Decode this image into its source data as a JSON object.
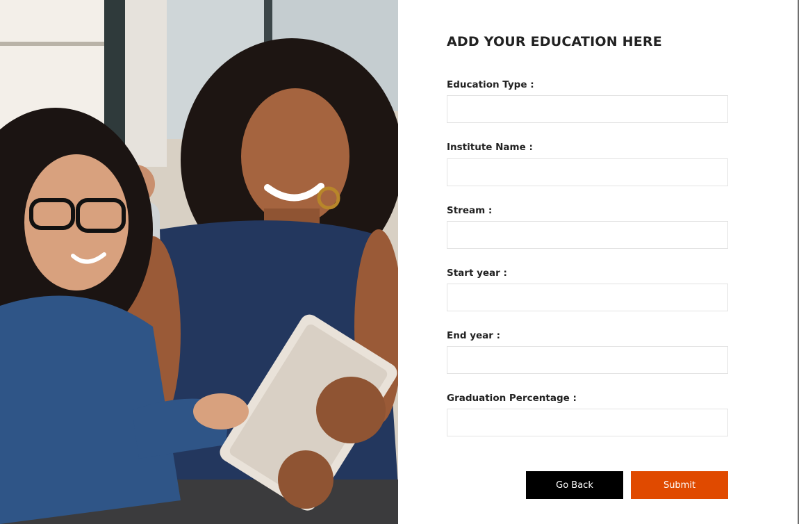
{
  "form": {
    "title": "ADD YOUR EDUCATION HERE",
    "fields": [
      {
        "label": "Education Type :",
        "value": "",
        "placeholder": ""
      },
      {
        "label": "Institute Name :",
        "value": "",
        "placeholder": ""
      },
      {
        "label": "Stream :",
        "value": "",
        "placeholder": ""
      },
      {
        "label": "Start year :",
        "value": "",
        "placeholder": ""
      },
      {
        "label": "End year :",
        "value": "",
        "placeholder": ""
      },
      {
        "label": "Graduation Percentage :",
        "value": "",
        "placeholder": ""
      }
    ],
    "buttons": {
      "back_label": "Go Back",
      "submit_label": "Submit"
    }
  },
  "colors": {
    "submit_button": "#e04a00",
    "back_button": "#000000",
    "text": "#222222",
    "input_border": "#e2e2e2"
  }
}
